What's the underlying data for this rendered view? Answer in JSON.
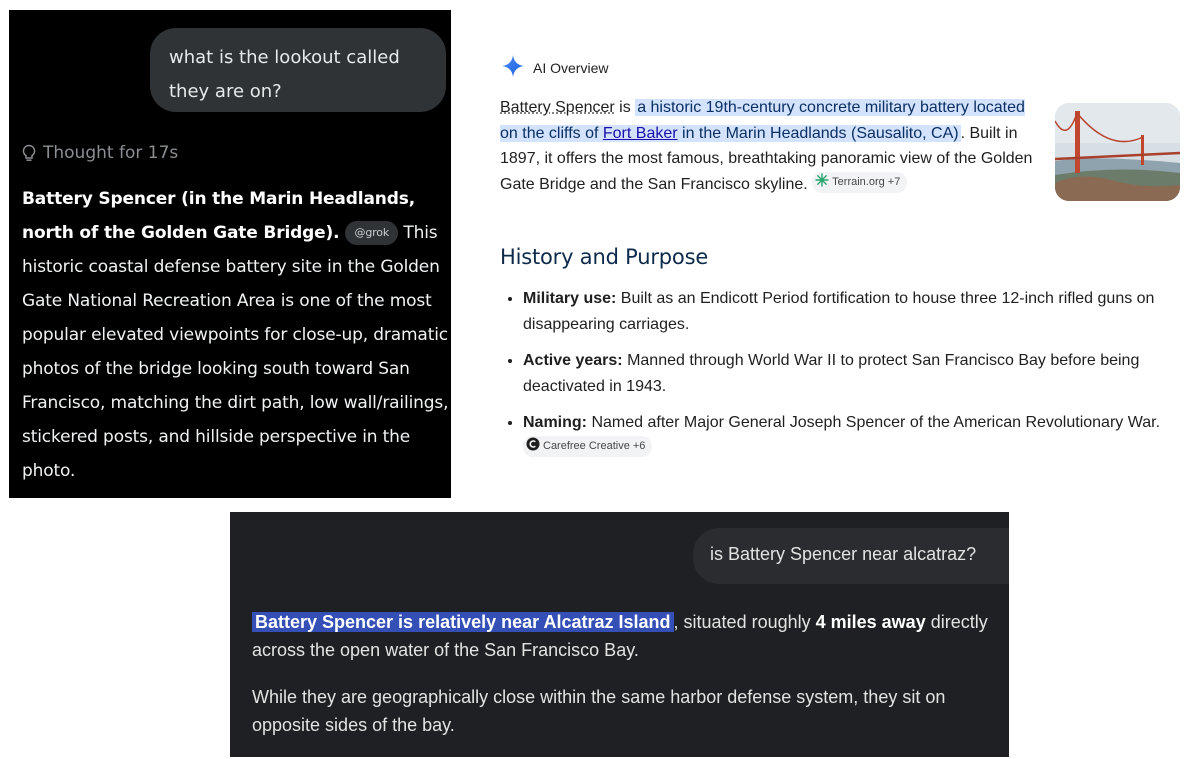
{
  "grok": {
    "user_question": "what is the lookout called they are on?",
    "thought_label": "Thought for 17s",
    "answer_title": "Battery Spencer (in the Marin Headlands, north of the Golden Gate Bridge).",
    "handle_tag": "@grok",
    "answer_body": "This historic coastal defense battery site in the Golden Gate National Recreation Area is one of the most popular elevated viewpoints for close-up, dramatic photos of the bridge looking south toward San Francisco, matching the dirt path, low wall/railings, stickered posts, and hillside perspective in the photo."
  },
  "google": {
    "header_label": "AI Overview",
    "entity": "Battery Spencer",
    "intro_is": " is ",
    "highlight_pre": "a historic 19th-century concrete military battery located on the cliffs of ",
    "highlight_link": "Fort Baker",
    "highlight_post": " in the Marin Headlands (Sausalito, CA)",
    "intro_rest": ". Built in 1897, it offers the most famous, breathtaking panoramic view of the Golden Gate Bridge and the San Francisco skyline.",
    "source1": "Terrain.org +7",
    "section_title": "History and Purpose",
    "bullets": [
      {
        "label": "Military use:",
        "text": " Built as an Endicott Period fortification to house three 12-inch rifled guns on disappearing carriages."
      },
      {
        "label": "Active years:",
        "text": " Manned through World War II to protect San Francisco Bay before being deactivated in 1943."
      },
      {
        "label": "Naming:",
        "text": " Named after Major General Joseph Spencer of the American Revolutionary War."
      }
    ],
    "source2": "Carefree Creative +6",
    "colors": {
      "highlight": "#d3e3fd",
      "link": "#1a0dab",
      "heading": "#0e2a4a"
    }
  },
  "chat": {
    "user_question": "is Battery Spencer near alcatraz?",
    "highlight": "Battery Spencer is relatively near Alcatraz Island",
    "p1_mid": ", situated roughly ",
    "p1_bold": "4 miles away",
    "p1_end": " directly across the open water of the San Francisco Bay.",
    "p2": "While they are geographically close within the same harbor defense system, they sit on opposite sides of the bay.",
    "colors": {
      "background": "#1f2023",
      "highlight": "#3450b6"
    }
  }
}
